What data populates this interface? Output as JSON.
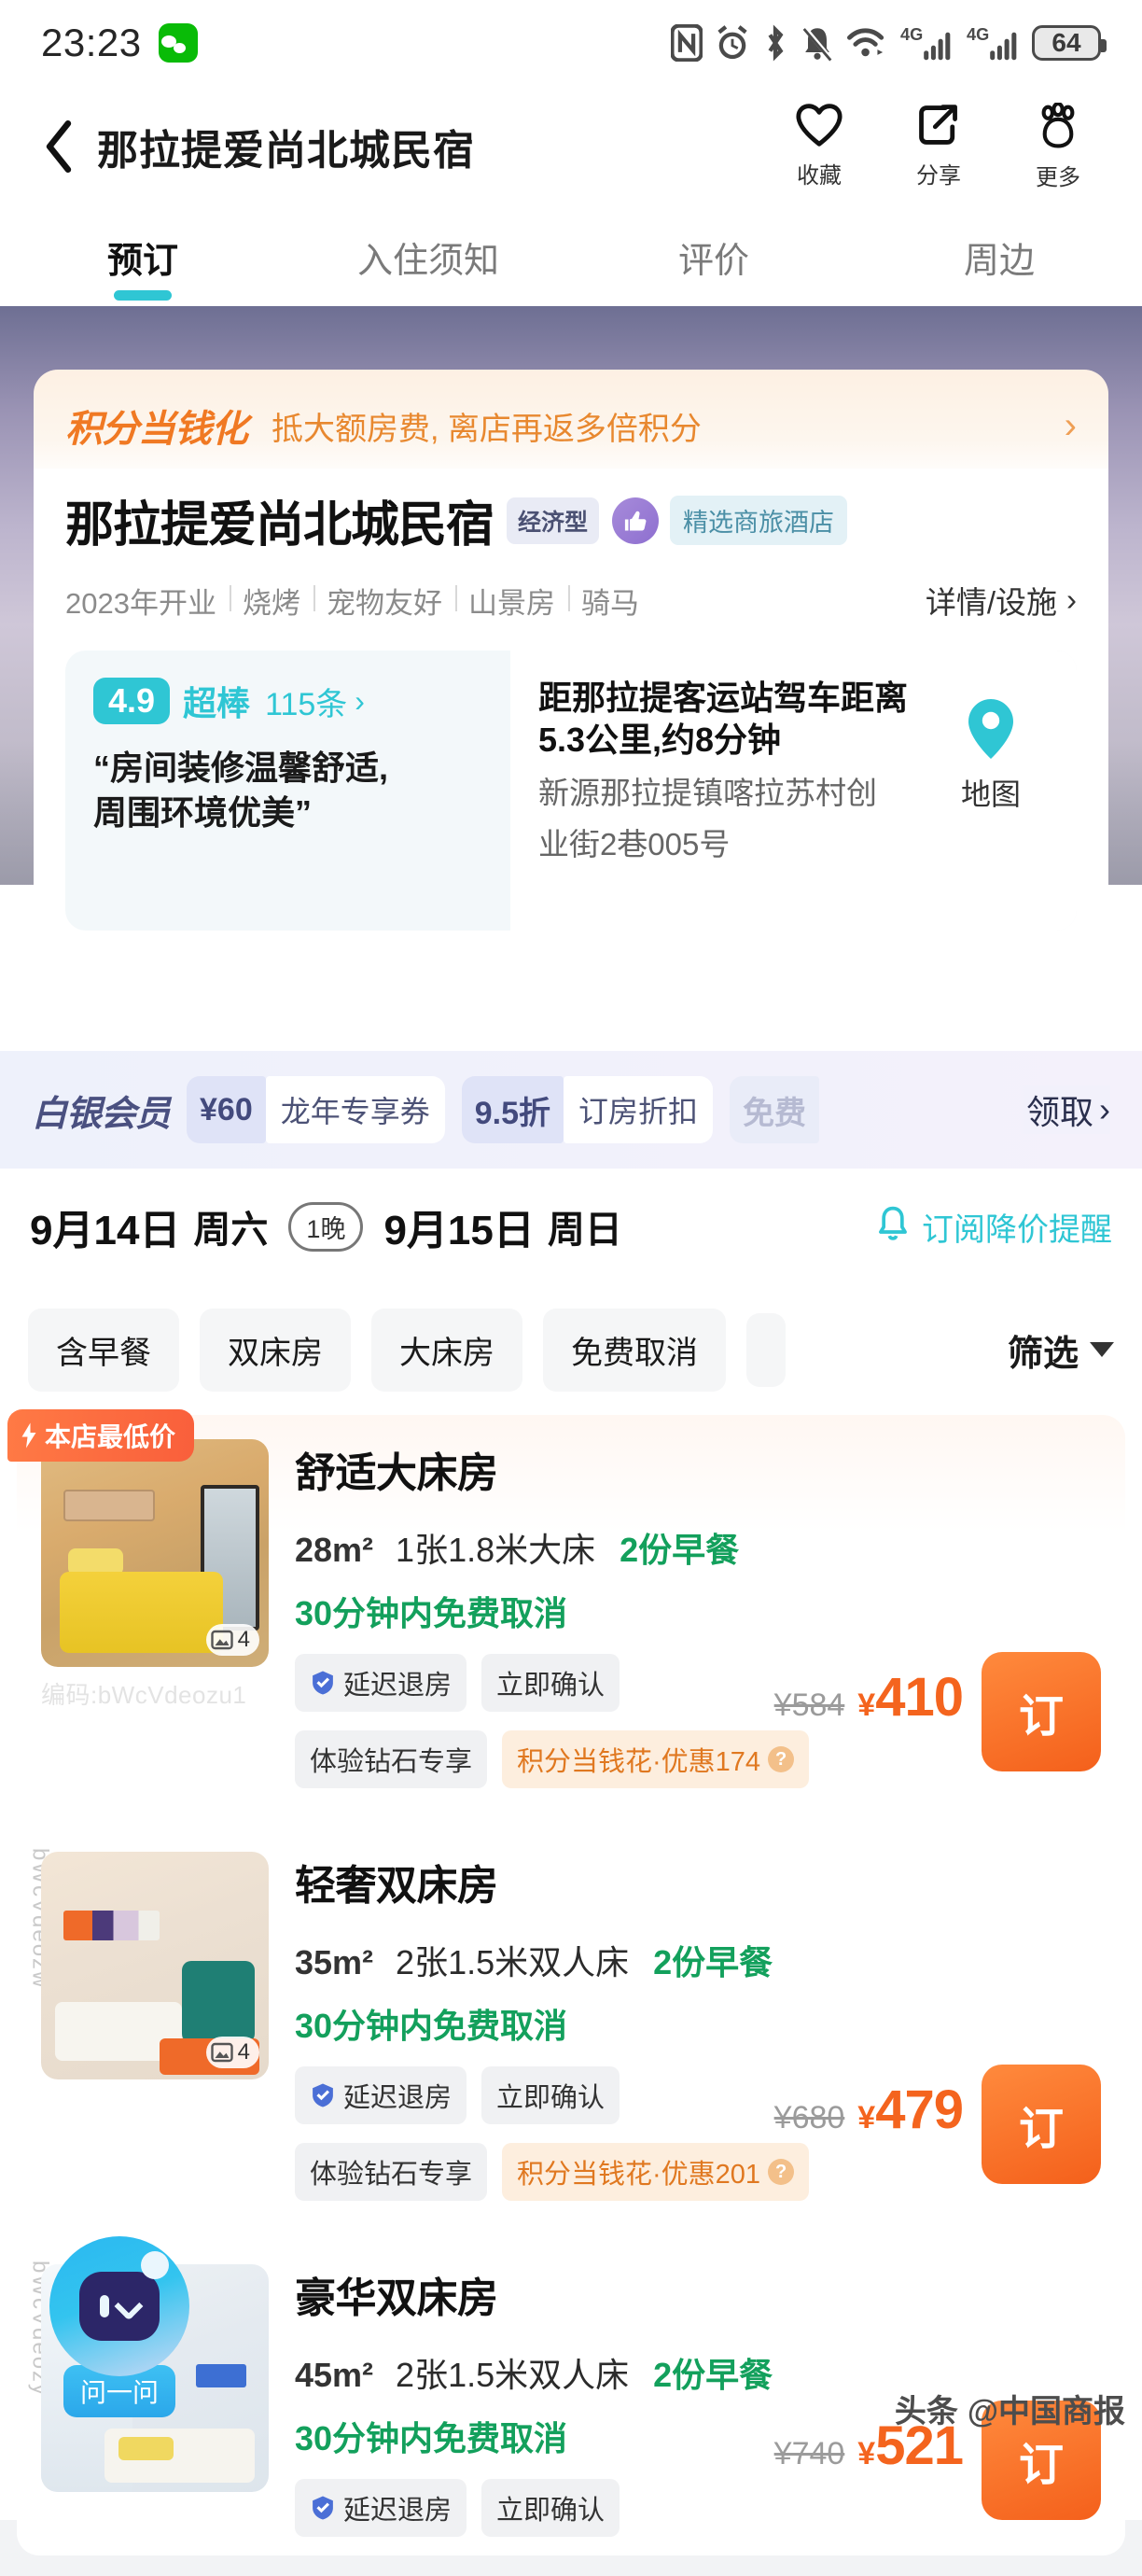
{
  "statusbar": {
    "time": "23:23",
    "battery": "64",
    "icons": [
      "wechat-icon",
      "nfc-icon",
      "alarm-icon",
      "bluetooth-icon",
      "mute-bell-icon",
      "wifi-icon",
      "signal-4g-icon",
      "signal-4g-icon-2",
      "battery-icon"
    ]
  },
  "navbar": {
    "title": "那拉提爱尚北城民宿",
    "actions": [
      {
        "label": "收藏",
        "icon": "heart-icon"
      },
      {
        "label": "分享",
        "icon": "share-icon"
      },
      {
        "label": "更多",
        "icon": "more-paw-icon"
      }
    ]
  },
  "tabs": [
    {
      "label": "预订",
      "active": true
    },
    {
      "label": "入住须知",
      "active": false
    },
    {
      "label": "评价",
      "active": false
    },
    {
      "label": "周边",
      "active": false
    }
  ],
  "points_banner": {
    "tag": "积分当钱化",
    "desc": "抵大额房费, 离店再返多倍积分",
    "arrow": "›"
  },
  "hotel": {
    "name": "那拉提爱尚北城民宿",
    "badge_economy": "经济型",
    "badge_selected": "精选商旅酒店",
    "features": [
      "2023年开业",
      "烧烤",
      "宠物友好",
      "山景房",
      "骑马"
    ],
    "detail_link": "详情/设施",
    "detail_arrow": "›"
  },
  "review": {
    "score": "4.9",
    "word": "超棒",
    "count": "115条",
    "arrow": "›",
    "quote": "“房间装修温馨舒适,\n周围环境优美”",
    "quote_line1": "“房间装修温馨舒适,",
    "quote_line2": "周围环境优美”"
  },
  "location": {
    "distance_line1": "距那拉提客运站驾车距离",
    "distance_line2": "5.3公里,约8分钟",
    "address_line1": "新源那拉提镇喀拉苏村创",
    "address_line2": "业街2巷005号",
    "map_label": "地图"
  },
  "member": {
    "title": "白银会员",
    "coupons": [
      {
        "amount": "¥60",
        "name": "龙年专享券"
      },
      {
        "amount": "9.5折",
        "name": "订房折扣"
      },
      {
        "amount": "免费",
        "name": ""
      }
    ],
    "get_label": "领取",
    "get_arrow": "›"
  },
  "dates": {
    "checkin_date": "9月14日",
    "checkin_week": "周六",
    "nights": "1晚",
    "checkout_date": "9月15日",
    "checkout_week": "周日",
    "alert_label": "订阅降价提醒"
  },
  "filters": {
    "chips": [
      "含早餐",
      "双床房",
      "大床房",
      "免费取消"
    ],
    "more_label": "筛选"
  },
  "rooms": [
    {
      "name": "舒适大床房",
      "size": "28m²",
      "bed": "1张1.8米大床",
      "breakfast": "2份早餐",
      "cancel": "30分钟内免费取消",
      "tags": [
        "延迟退房",
        "立即确认"
      ],
      "diamond_tag": "体验钻石专享",
      "points_tag": "积分当钱花·优惠174",
      "old_price": "¥584",
      "currency": "¥",
      "price": "410",
      "book_label": "订",
      "lowest_badge": "本店最低价",
      "image_count": "4",
      "code": "编码:bWcVdeozu1"
    },
    {
      "name": "轻奢双床房",
      "size": "35m²",
      "bed": "2张1.5米双人床",
      "breakfast": "2份早餐",
      "cancel": "30分钟内免费取消",
      "tags": [
        "延迟退房",
        "立即确认"
      ],
      "diamond_tag": "体验钻石专享",
      "points_tag": "积分当钱花·优惠201",
      "old_price": "¥680",
      "currency": "¥",
      "price": "479",
      "book_label": "订",
      "lowest_badge": "",
      "image_count": "4",
      "code": ""
    },
    {
      "name": "豪华双床房",
      "size": "45m²",
      "bed": "2张1.5米双人床",
      "breakfast": "2份早餐",
      "cancel": "30分钟内免费取消",
      "tags": [
        "延迟退房",
        "立即确认"
      ],
      "diamond_tag": "",
      "points_tag": "",
      "old_price": "¥740",
      "currency": "¥",
      "price": "521",
      "book_label": "订",
      "lowest_badge": "",
      "image_count": "",
      "code": ""
    }
  ],
  "watermarks": {
    "side_text_2": "bWcVdeozw",
    "side_text_3": "bWcVdeozy",
    "news_source": "头条",
    "news_account": "@中国商报"
  },
  "ask": {
    "label": "问一问"
  },
  "colors": {
    "accent_cyan": "#2fc6d4",
    "accent_orange": "#f4601b",
    "green": "#13a05c",
    "member_blue": "#4a5080"
  }
}
